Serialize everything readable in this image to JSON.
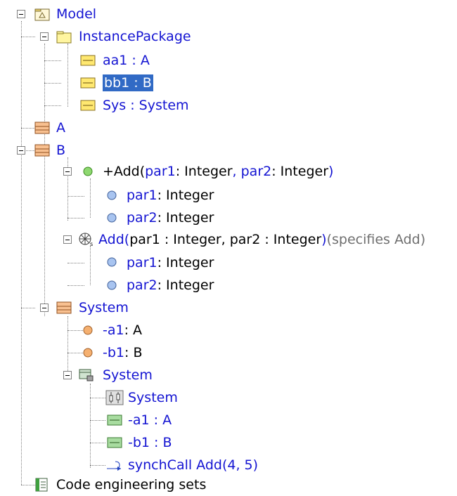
{
  "tree": {
    "model": "Model",
    "instance_package": "InstancePackage",
    "aa1": "aa1 : A",
    "bb1": "bb1 : B",
    "sys": "Sys : System",
    "class_a": "A",
    "class_b": "B",
    "op_add_name": "+Add(",
    "op_par1": "par1",
    "op_sep1": " : Integer",
    "op_comma": ", par2",
    "op_sep2": " : Integer",
    "op_close": " )",
    "p1_name": "par1",
    "p1_type": " : Integer",
    "p2_name": "par2",
    "p2_type": " : Integer",
    "beh_name": "Add(",
    "beh_par1": " par1 : Integer, par2 : Integer ",
    "beh_close": ")",
    "beh_spec": "(specifies Add)",
    "bp1_name": "par1",
    "bp1_type": " : Integer",
    "bp2_name": "par2",
    "bp2_type": " : Integer",
    "system": "System",
    "a1_name": "-a1",
    "a1_type": " : A",
    "b1_name": "-b1",
    "b1_type": " : B",
    "sys_internal": "System",
    "sys_diagram": "System",
    "part_a1": "-a1 : A",
    "part_b1": "-b1 : B",
    "synch_call": "synchCall Add(4, 5)",
    "code_sets": "Code engineering sets"
  },
  "colors": {
    "link": "#1414d2",
    "selection": "#316ac5"
  }
}
